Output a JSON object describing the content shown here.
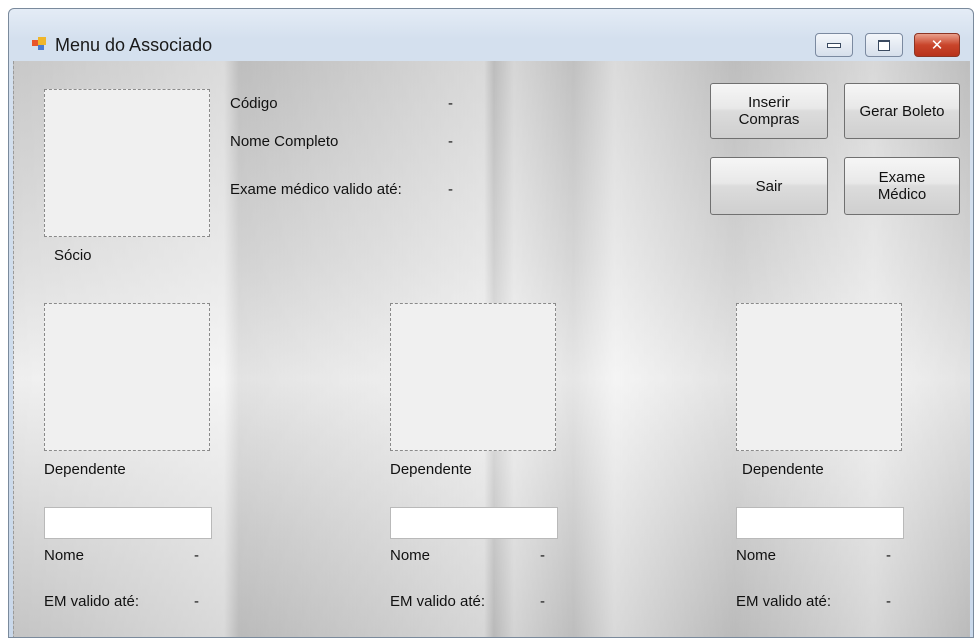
{
  "window": {
    "title": "Menu do Associado"
  },
  "titlebar_icons": {
    "app": "app-window-icon",
    "minimize": "minimize-icon",
    "maximize": "maximize-icon",
    "close": "close-icon",
    "close_glyph": "✕"
  },
  "socio": {
    "photo_caption": "Sócio",
    "code_label": "Código",
    "code_value": "-",
    "name_label": "Nome Completo",
    "name_value": "-",
    "exam_label": "Exame médico valido até:",
    "exam_value": "-"
  },
  "buttons": {
    "inserir_compras": "Inserir\nCompras",
    "gerar_boleto": "Gerar Boleto",
    "sair": "Sair",
    "exame_medico": "Exame\nMédico"
  },
  "dependents": [
    {
      "caption": "Dependente",
      "name_input": "",
      "name_label": "Nome",
      "name_value": "-",
      "em_label": "EM valido até:",
      "em_value": "-"
    },
    {
      "caption": "Dependente",
      "name_input": "",
      "name_label": "Nome",
      "name_value": "-",
      "em_label": "EM valido até:",
      "em_value": "-"
    },
    {
      "caption": "Dependente",
      "name_input": "",
      "name_label": "Nome",
      "name_value": "-",
      "em_label": "EM valido até:",
      "em_value": "-"
    }
  ]
}
